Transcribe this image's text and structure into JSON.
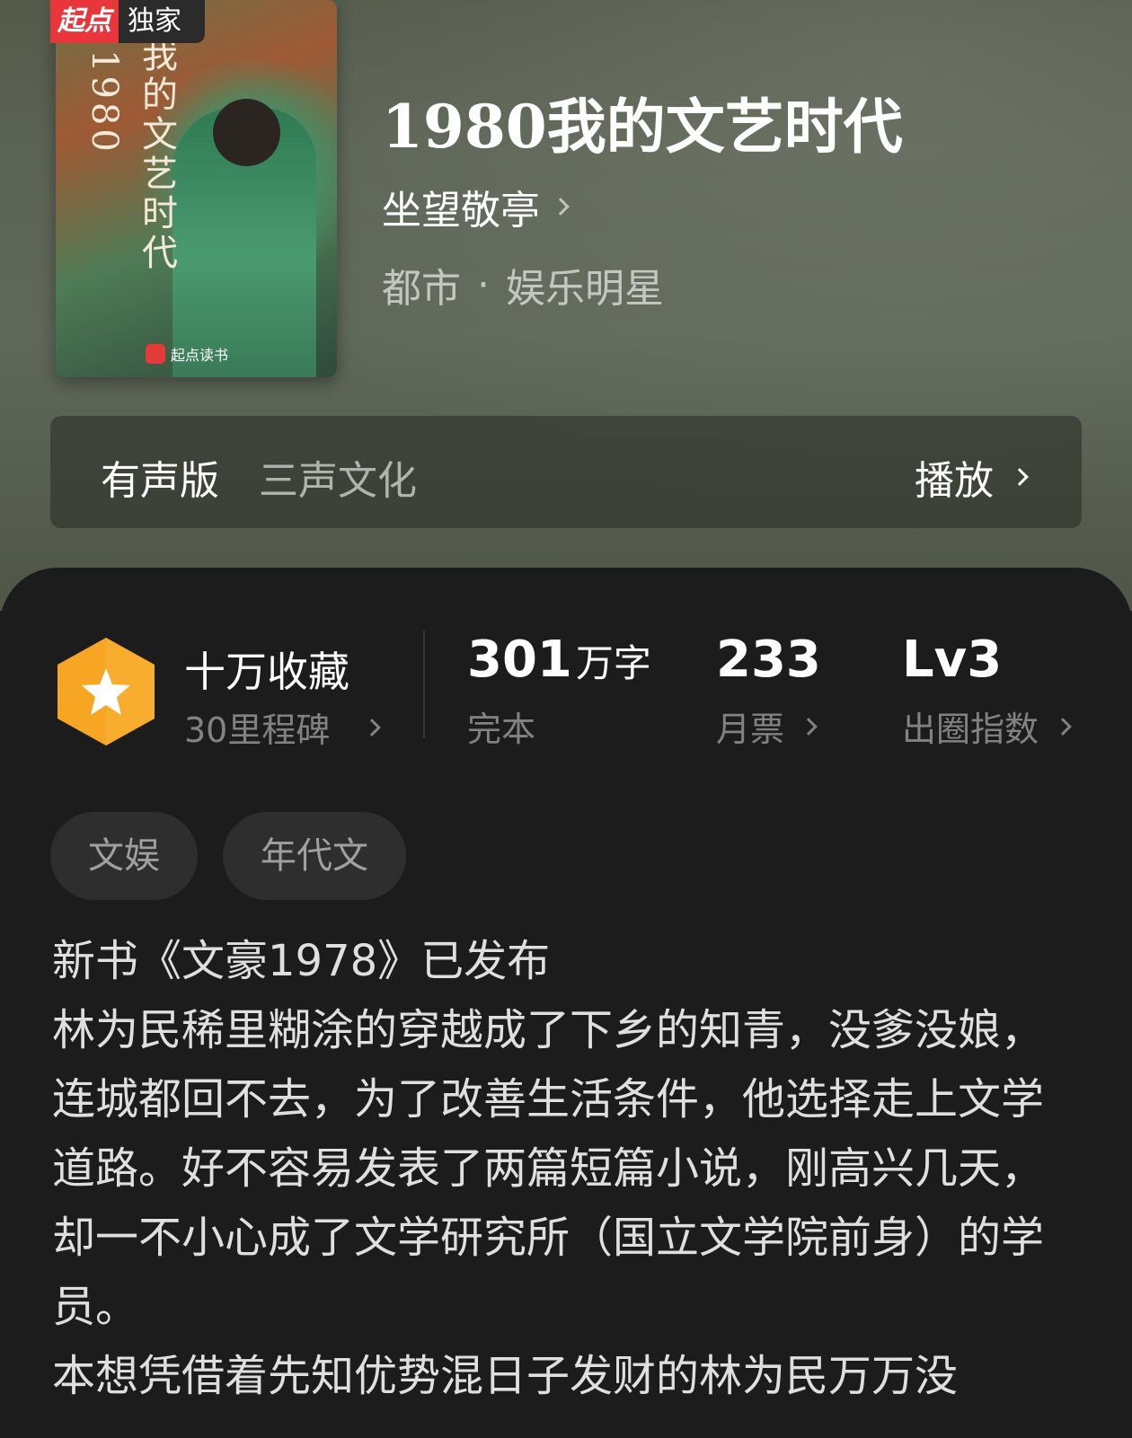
{
  "book": {
    "exclusive_brand": "起点",
    "exclusive_label": "独家",
    "cover_title_num": "1980",
    "cover_title_text": "我的文艺时代",
    "cover_publisher": "起点读书",
    "title": "1980我的文艺时代",
    "author": "坐望敬亭",
    "genre_main": "都市",
    "genre_sep": "·",
    "genre_sub": "娱乐明星"
  },
  "audio": {
    "label": "有声版",
    "studio": "三声文化",
    "play_label": "播放"
  },
  "stats": {
    "collect_title": "十万收藏",
    "collect_sub": "30里程碑",
    "words_value": "301",
    "words_unit": "万字",
    "words_label": "完本",
    "votes_value": "233",
    "votes_label": "月票",
    "level_value": "Lv3",
    "level_label": "出圈指数"
  },
  "tags": [
    "文娱",
    "年代文"
  ],
  "description": [
    "新书《文豪1978》已发布",
    "林为民稀里糊涂的穿越成了下乡的知青，没爹没娘，连城都回不去，为了改善生活条件，他选择走上文学道路。好不容易发表了两篇短篇小说，刚高兴几天，却一不小心成了文学研究所（国立文学院前身）的学员。",
    "本想凭借着先知优势混日子发财的林为民万万没"
  ],
  "colors": {
    "badge_gold": "#f6a623",
    "exclusive_red": "#e8363a"
  }
}
